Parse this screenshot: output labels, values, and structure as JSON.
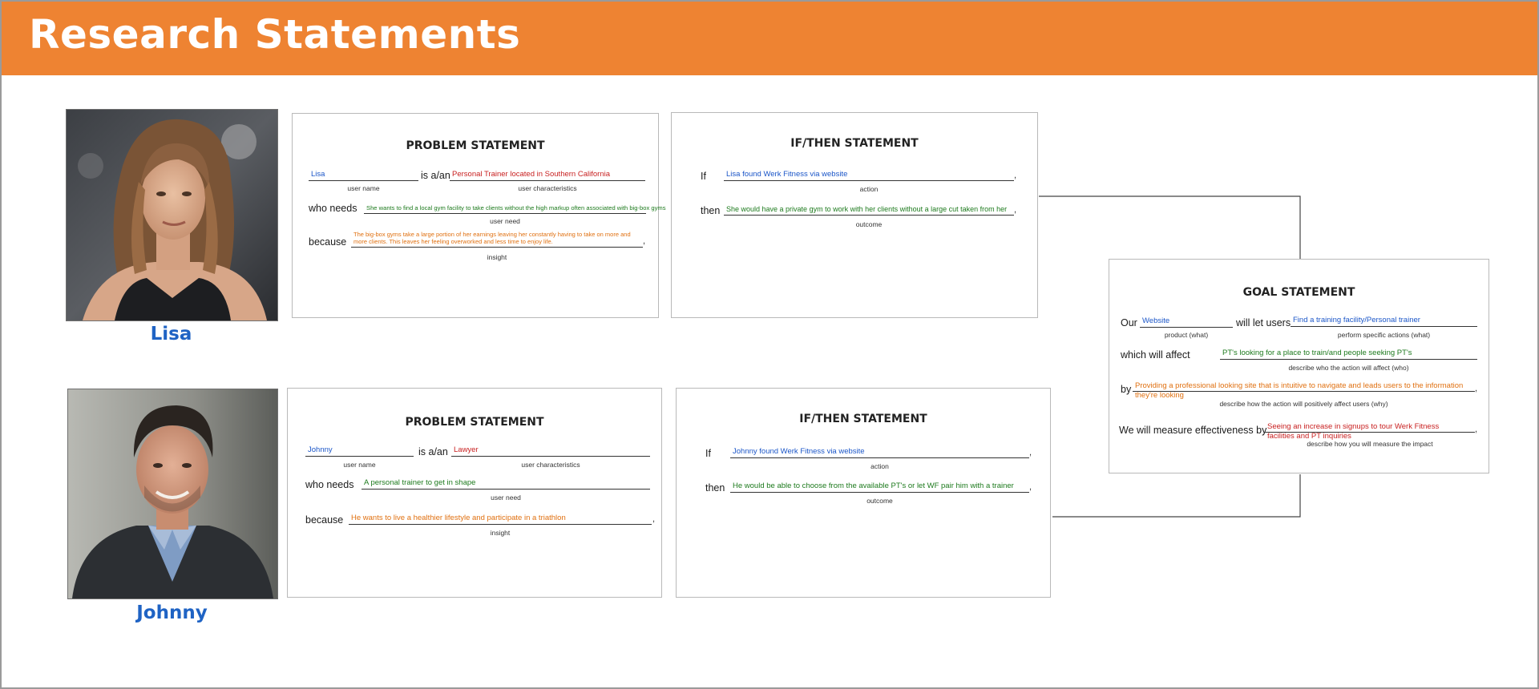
{
  "header": {
    "title": "Research Statements"
  },
  "colors": {
    "header_bg": "#ee8332",
    "persona_name": "#1f63c4",
    "value_blue": "#1b56c8",
    "value_red": "#c81f1f",
    "value_green": "#1d7a1d",
    "value_orange": "#e07010"
  },
  "personas": [
    {
      "name": "Lisa",
      "problem": {
        "title": "PROBLEM STATEMENT",
        "user_name_label": "user name",
        "user_name": "Lisa",
        "is_label": "is a/an",
        "characteristics_label": "user characteristics",
        "characteristics": "Personal Trainer located in Southern California",
        "needs_label": "who needs",
        "need_caption": "user need",
        "need": "She wants to find a local gym facility to take clients without the high markup often associated with big-box gyms",
        "because_label": "because",
        "insight_caption": "insight",
        "insight": "The big-box gyms take a large portion of her earnings leaving her constantly having to take on more and more clients. This leaves her feeling overworked and less time to enjoy life."
      },
      "ifthen": {
        "title": "IF/THEN STATEMENT",
        "if_label": "If",
        "action_caption": "action",
        "action": "Lisa found Werk Fitness via website",
        "then_label": "then",
        "outcome_caption": "outcome",
        "outcome": "She would have a private gym to work with her clients without a large cut taken from her"
      }
    },
    {
      "name": "Johnny",
      "problem": {
        "title": "PROBLEM STATEMENT",
        "user_name_label": "user name",
        "user_name": "Johnny",
        "is_label": "is a/an",
        "characteristics_label": "user characteristics",
        "characteristics": "Lawyer",
        "needs_label": "who needs",
        "need_caption": "user need",
        "need": "A personal trainer to get in shape",
        "because_label": "because",
        "insight_caption": "insight",
        "insight": "He wants to live a healthier lifestyle and participate in a triathlon"
      },
      "ifthen": {
        "title": "IF/THEN STATEMENT",
        "if_label": "If",
        "action_caption": "action",
        "action": "Johnny found Werk Fitness via website",
        "then_label": "then",
        "outcome_caption": "outcome",
        "outcome": "He would be able to choose from the available PT's or let WF pair him with a trainer"
      }
    }
  ],
  "goal": {
    "title": "GOAL STATEMENT",
    "our_label": "Our",
    "product": "Website",
    "product_caption": "product (what)",
    "let_users_label": "will let users",
    "actions": "Find a training facility/Personal trainer",
    "actions_caption": "perform specific actions (what)",
    "affect_label": "which will affect",
    "who": "PT's looking for a place to train/and people seeking PT's",
    "who_caption": "describe who the action will affect (who)",
    "by_label": "by",
    "why": "Providing a professional looking site that is intuitive to navigate and leads users to the information they're looking",
    "why_caption": "describe how the action will positively affect users (why)",
    "measure_label": "We will measure effectiveness by",
    "impact": "Seeing an increase in signups to tour Werk Fitness facilities and PT inquiries",
    "impact_caption": "describe how you will measure the impact"
  }
}
